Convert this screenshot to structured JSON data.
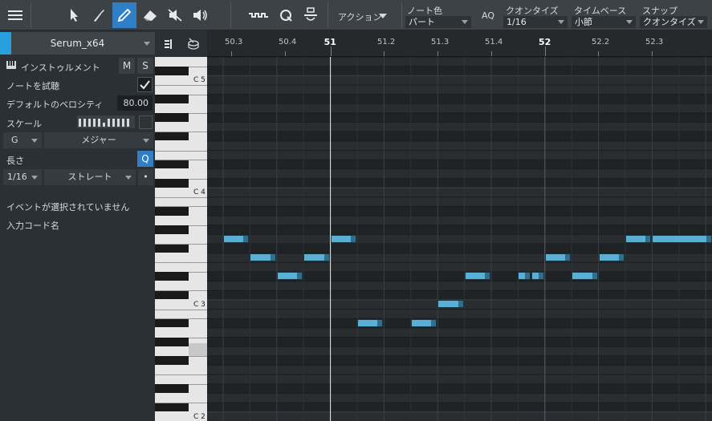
{
  "toolbar": {
    "action_label": "アクション",
    "note_color": {
      "label": "ノート色",
      "value": "パート"
    },
    "aq_label": "AQ",
    "quantize": {
      "label": "クオンタイズ",
      "value": "1/16"
    },
    "timebase": {
      "label": "タイムベース",
      "value": "小節"
    },
    "snap": {
      "label": "スナップ",
      "value": "クオンタイズ"
    }
  },
  "inspector": {
    "instrument_name": "Serum_x64",
    "instrument_label": "インストゥルメント",
    "mute_label": "M",
    "solo_label": "S",
    "audition_label": "ノートを試聴",
    "default_velocity_label": "デフォルトのベロシティ",
    "default_velocity_value": "80.00",
    "scale_label": "スケール",
    "scale_key": "G",
    "scale_type": "メジャー",
    "length_label": "長さ",
    "length_q": "Q",
    "length_value": "1/16",
    "length_mode": "ストレート",
    "length_dot": "•",
    "no_event_text": "イベントが選択されていません",
    "input_chord_label": "入力コード名"
  },
  "ruler": {
    "ticks": [
      {
        "label": "50.3",
        "major": false
      },
      {
        "label": "50.4",
        "major": false
      },
      {
        "label": "51",
        "major": true
      },
      {
        "label": "51.2",
        "major": false
      },
      {
        "label": "51.3",
        "major": false
      },
      {
        "label": "51.4",
        "major": false
      },
      {
        "label": "52",
        "major": true
      },
      {
        "label": "52.2",
        "major": false
      },
      {
        "label": "52.3",
        "major": false
      }
    ]
  },
  "piano": {
    "octave_labels": [
      "C 5",
      "C 4",
      "C 3",
      "C 2"
    ]
  },
  "colors": {
    "accent": "#2e7fc6",
    "note": "#5ab0d4"
  },
  "notes": [
    {
      "beat": 0.0,
      "len": 1,
      "pitch": 55
    },
    {
      "beat": 1.0,
      "len": 1,
      "pitch": 53
    },
    {
      "beat": 2.0,
      "len": 1,
      "pitch": 51
    },
    {
      "beat": 3.0,
      "len": 1,
      "pitch": 53
    },
    {
      "beat": 4.0,
      "len": 1,
      "pitch": 55
    },
    {
      "beat": 5.0,
      "len": 1,
      "pitch": 46
    },
    {
      "beat": 7.0,
      "len": 1,
      "pitch": 46
    },
    {
      "beat": 8.0,
      "len": 1,
      "pitch": 48
    },
    {
      "beat": 9.0,
      "len": 1,
      "pitch": 51
    },
    {
      "beat": 11.0,
      "len": 0.5,
      "pitch": 51
    },
    {
      "beat": 11.5,
      "len": 0.5,
      "pitch": 51
    },
    {
      "beat": 12.0,
      "len": 1,
      "pitch": 53
    },
    {
      "beat": 13.0,
      "len": 1,
      "pitch": 51
    },
    {
      "beat": 14.0,
      "len": 1,
      "pitch": 53
    },
    {
      "beat": 15.0,
      "len": 1,
      "pitch": 55
    },
    {
      "beat": 16.0,
      "len": 3,
      "pitch": 55
    }
  ]
}
